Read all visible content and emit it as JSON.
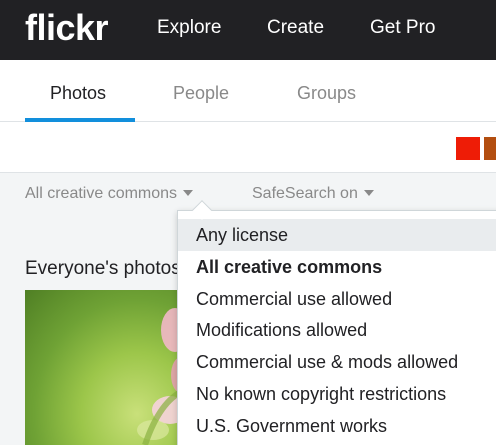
{
  "header": {
    "logo": "flickr",
    "nav": [
      {
        "label": "Explore"
      },
      {
        "label": "Create"
      },
      {
        "label": "Get Pro"
      }
    ]
  },
  "tabs": [
    {
      "label": "Photos",
      "active": true
    },
    {
      "label": "People"
    },
    {
      "label": "Groups"
    }
  ],
  "colors": {
    "accent": "#128fdc",
    "topbar": "#212124",
    "swatch_red": "#ee1c06",
    "swatch_brown": "#b34e10"
  },
  "filters": {
    "license": "All creative commons",
    "safesearch": "SafeSearch on"
  },
  "section_title": "Everyone's photos",
  "license_menu": {
    "items": [
      {
        "label": "Any license",
        "state": "hover"
      },
      {
        "label": "All creative commons",
        "state": "selected"
      },
      {
        "label": "Commercial use allowed"
      },
      {
        "label": "Modifications allowed"
      },
      {
        "label": "Commercial use & mods allowed"
      },
      {
        "label": "No known copyright restrictions"
      },
      {
        "label": "U.S. Government works"
      }
    ]
  }
}
